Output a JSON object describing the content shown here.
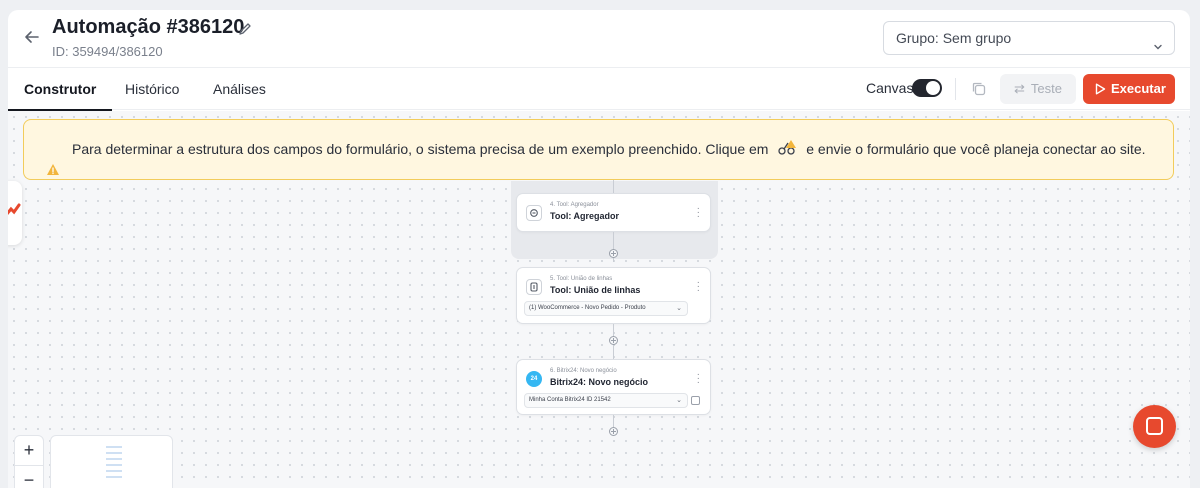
{
  "header": {
    "title": "Automação #386120",
    "subtitle": "ID: 359494/386120",
    "group_select": "Grupo: Sem grupo"
  },
  "tabs": [
    {
      "label": "Construtor",
      "active": true
    },
    {
      "label": "Histórico",
      "active": false
    },
    {
      "label": "Análises",
      "active": false
    }
  ],
  "toolbar": {
    "canvas_label": "Canvas",
    "canvas_toggle_on": true,
    "test_label": "Teste",
    "run_label": "Executar"
  },
  "alert": {
    "text_before": "Para determinar a estrutura dos campos do formulário, o sistema precisa de um exemplo preenchido. Clique em",
    "text_after": "e envie o formulário que você planeja conectar ao site."
  },
  "nodes": [
    {
      "small": "4. Tool: Agregador",
      "title": "Tool: Agregador",
      "icon": "aggregator-icon"
    },
    {
      "small": "5. Tool: União de linhas",
      "title": "Tool: União de linhas",
      "icon": "merge-icon",
      "select": "(1) WooCommerce - Novo Pedido - Produto"
    },
    {
      "small": "6. Bitrix24: Novo negócio",
      "title": "Bitrix24: Novo negócio",
      "icon_text": "24",
      "select": "Minha Conta Bitrix24 ID 21542"
    }
  ],
  "zoom": {
    "in": "+",
    "out": "−"
  },
  "colors": {
    "accent": "#e7492e",
    "warning_bg": "#fff7e0",
    "warning_border": "#f2cc5b",
    "bitrix": "#35b7f2"
  }
}
